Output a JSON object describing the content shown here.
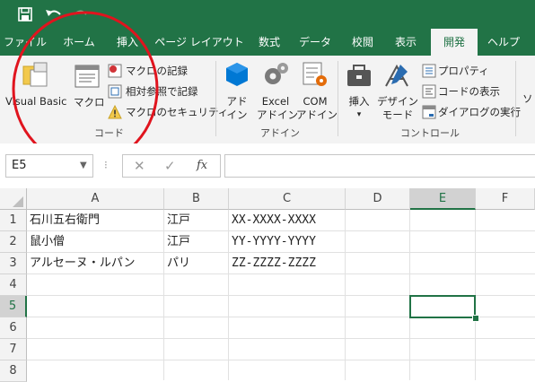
{
  "tabs": [
    {
      "label": "ファイル",
      "active": false
    },
    {
      "label": "ホーム",
      "active": false
    },
    {
      "label": "挿入",
      "active": false
    },
    {
      "label": "ページ レイアウト",
      "active": false
    },
    {
      "label": "数式",
      "active": false
    },
    {
      "label": "データ",
      "active": false
    },
    {
      "label": "校閲",
      "active": false
    },
    {
      "label": "表示",
      "active": false
    },
    {
      "label": "開発",
      "active": true
    },
    {
      "label": "ヘルプ",
      "active": false
    }
  ],
  "ribbon": {
    "code": {
      "visual_basic": "Visual Basic",
      "macro": "マクロ",
      "record_macro": "マクロの記録",
      "relative_ref": "相対参照で記録",
      "macro_security": "マクロのセキュリティ",
      "group_label": "コード"
    },
    "addins": {
      "addin_line1": "アド",
      "addin_line2": "イン",
      "excel_line1": "Excel",
      "excel_line2": "アドイン",
      "com_line1": "COM",
      "com_line2": "アドイン",
      "group_label": "アドイン"
    },
    "controls": {
      "insert": "挿入",
      "design_line1": "デザイン",
      "design_line2": "モード",
      "properties": "プロパティ",
      "view_code": "コードの表示",
      "run_dialog": "ダイアログの実行",
      "group_label": "コントロール"
    }
  },
  "formula_bar": {
    "name_box": "E5",
    "fx": "fx",
    "value": ""
  },
  "grid": {
    "columns": [
      "A",
      "B",
      "C",
      "D",
      "E",
      "F"
    ],
    "rows": [
      "1",
      "2",
      "3",
      "4",
      "5",
      "6",
      "7",
      "8"
    ],
    "selected_cell": "E5",
    "cells": [
      [
        "石川五右衛門",
        "江戸",
        "XX-XXXX-XXXX"
      ],
      [
        "鼠小僧",
        "江戸",
        "YY-YYYY-YYYY"
      ],
      [
        "アルセーヌ・ルパン",
        "パリ",
        "ZZ-ZZZZ-ZZZZ"
      ]
    ]
  },
  "colors": {
    "excel_green": "#217346",
    "annotation_red": "#e0141e"
  }
}
